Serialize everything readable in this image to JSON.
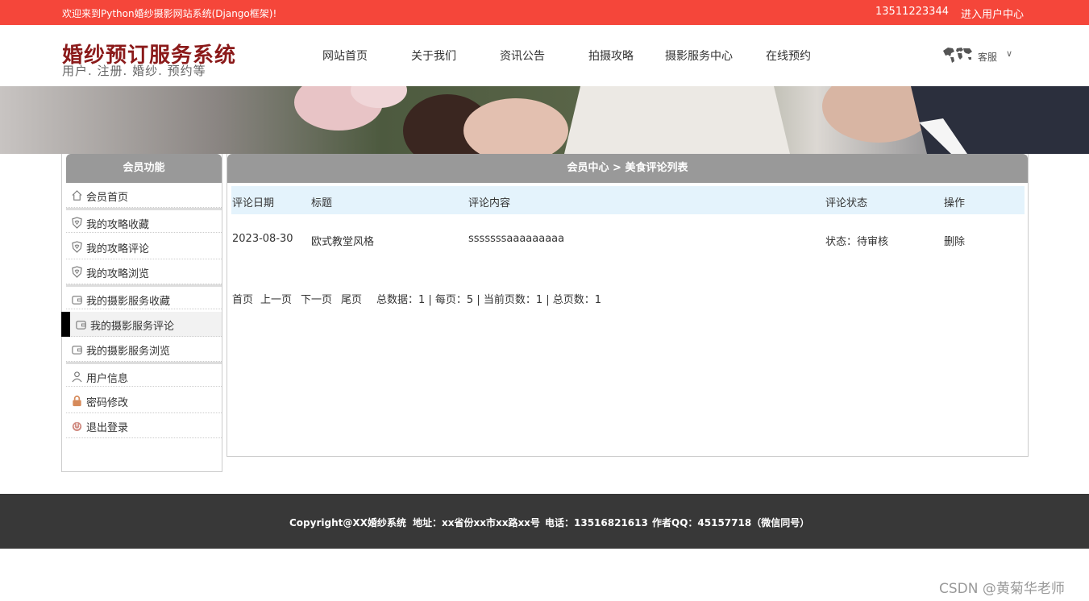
{
  "topbar": {
    "welcome": "欢迎来到Python婚纱摄影网站系统(Django框架)!",
    "phone": "13511223344",
    "user_center": "进入用户中心"
  },
  "header": {
    "logo_title": "婚纱预订服务系统",
    "logo_subtitle": "用户. 注册. 婚纱. 预约等",
    "nav": [
      "网站首页",
      "关于我们",
      "资讯公告",
      "拍摄攻略",
      "摄影服务中心",
      "在线预约"
    ],
    "service_label": "客服",
    "service_icon": "world-map-icon"
  },
  "sidebar": {
    "title": "会员功能",
    "items": [
      {
        "label": "会员首页",
        "icon": "home-icon"
      },
      {
        "label": "我的攻略收藏",
        "icon": "heart-shield-icon"
      },
      {
        "label": "我的攻略评论",
        "icon": "heart-shield-icon"
      },
      {
        "label": "我的攻略浏览",
        "icon": "heart-shield-icon"
      },
      {
        "label": "我的摄影服务收藏",
        "icon": "wallet-icon"
      },
      {
        "label": "我的摄影服务评论",
        "icon": "wallet-icon"
      },
      {
        "label": "我的摄影服务浏览",
        "icon": "wallet-icon"
      },
      {
        "label": "用户信息",
        "icon": "user-icon"
      },
      {
        "label": "密码修改",
        "icon": "lock-icon"
      },
      {
        "label": "退出登录",
        "icon": "power-icon"
      }
    ]
  },
  "main": {
    "breadcrumb": "会员中心 > 美食评论列表",
    "columns": [
      "评论日期",
      "标题",
      "评论内容",
      "评论状态",
      "操作"
    ],
    "rows": [
      {
        "date": "2023-08-30",
        "title": "欧式教堂风格",
        "content": "sssssssaaaaaaaaa",
        "status": "状态：待审核",
        "action": "删除"
      }
    ],
    "pager": {
      "first": "首页",
      "prev": "上一页",
      "next": "下一页",
      "last": "尾页",
      "info": "总数据：1 | 每页：5 | 当前页数：1 | 总页数：1"
    }
  },
  "footer": {
    "copyright": "Copyright@XX婚纱系统",
    "address": "地址：xx省份xx市xx路xx号",
    "phone": "电话：13516821613",
    "qq": "作者QQ：45157718（微信同号）"
  },
  "watermark": "CSDN @黄菊华老师",
  "colors": {
    "topbar": "#f5463a",
    "logo": "#8b1a1a",
    "panel_header": "#999999",
    "table_header": "#e4f3fc",
    "footer": "#383838"
  }
}
